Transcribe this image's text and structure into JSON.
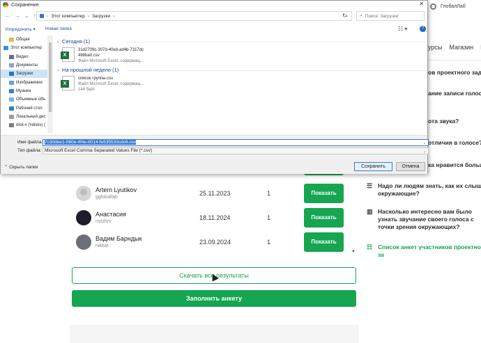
{
  "page": {
    "topbar_title": "ГлобалЛаб",
    "nav": [
      "урсы",
      "Магазин",
      "Н"
    ],
    "results": [
      {
        "name": "",
        "login": "",
        "date": "",
        "count": "",
        "avatar": "gray"
      },
      {
        "name": "Artem Lyutikov",
        "login": "ggloballab",
        "date": "25.11.2023",
        "count": "1",
        "avatar": "gray"
      },
      {
        "name": "Анастасия",
        "login": "nstzhrv",
        "date": "18.11.2024",
        "count": "1",
        "avatar": "dark"
      },
      {
        "name": "Вадим Барндык",
        "login": "nikkat",
        "date": "23.09.2024",
        "count": "1",
        "avatar": "photo"
      }
    ],
    "show_label": "Показать",
    "download_all_label": "Скачать все результаты",
    "fill_survey_label": "Заполнить анкету",
    "sidebar": {
      "item_1": "ов проектного задан",
      "item_2": "ание записи голоса с",
      "item_3": "ота звука?",
      "item_4": "отличия в голосе?",
      "item_5": "ка нравится больше",
      "item_6": "Надо ли людям знать, как их слышат окружающие?",
      "item_7": "Насколько интересно вам было узнать звучание своего голоса с точки зрения окружающих?",
      "item_8": "Список анкет участников проектного за"
    },
    "colors": {
      "accent": "#16a551",
      "link": "#1e3d8f"
    }
  },
  "dialog": {
    "title": "Сохранение",
    "address": {
      "part_1": "Этот компьютер",
      "part_2": "Загрузки"
    },
    "search_placeholder": "Поиск: Загрузки",
    "organize_label": "Упорядочить ▾",
    "new_folder_label": "Новая папка",
    "nav_items": [
      {
        "label": "Общая",
        "icon": "folder-icon"
      },
      {
        "label": "Этот компьютер",
        "icon": "computer-icon"
      },
      {
        "label": "Видео",
        "icon": "video-icon"
      },
      {
        "label": "Документы",
        "icon": "documents-icon"
      },
      {
        "label": "Загрузки",
        "icon": "downloads-icon"
      },
      {
        "label": "Изображения",
        "icon": "images-icon"
      },
      {
        "label": "Музыка",
        "icon": "music-icon"
      },
      {
        "label": "Объемные объ",
        "icon": "3d-objects-icon"
      },
      {
        "label": "Рабочий стол",
        "icon": "desktop-icon"
      },
      {
        "label": "Локальный дис",
        "icon": "drive-icon"
      },
      {
        "label": "disk-x (\\\\disks) (",
        "icon": "network-drive-icon"
      }
    ],
    "groups": [
      {
        "header": "Сегодня (1)",
        "file_name_1": "31d2709c-307d-40eb-ad4b-7317dc",
        "file_name_2": "498ba0.csv",
        "file_type": "Файл Microsoft Excel, содержащ...",
        "file_size": ""
      },
      {
        "header": "На прошлой неделе (1)",
        "file_name_1": "список группы.csv",
        "file_name_2": "",
        "file_type": "Файл Microsoft Excel, содержащ...",
        "file_size": "144 байт"
      }
    ],
    "filename_label": "Имя файла:",
    "filename_value": "7c30dee1-060e-4f4e-8014-fe535533cdc6.csv",
    "filetype_label": "Тип файла:",
    "filetype_value": "Microsoft Excel Comma Separated Values File (*.csv)",
    "hide_folders_label": "Скрыть папки",
    "save_label": "Сохранить",
    "cancel_label": "Отмена"
  }
}
